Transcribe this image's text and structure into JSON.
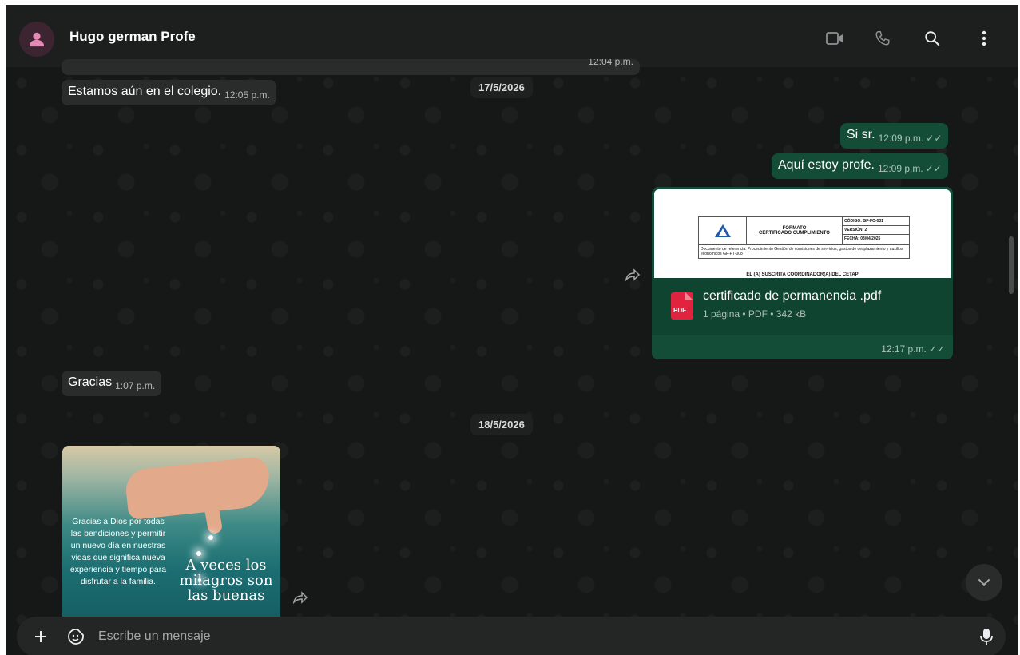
{
  "header": {
    "contact_name": "Hugo german Profe",
    "icons": [
      "video-call-icon",
      "voice-call-icon",
      "search-icon",
      "menu-icon"
    ]
  },
  "chat": {
    "partial_time": "12:04 p.m.",
    "dates": [
      "17/5/2026",
      "18/5/2026"
    ],
    "messages": [
      {
        "direction": "in",
        "text": "Estamos aún en el colegio.",
        "time": "12:05 p.m."
      },
      {
        "direction": "out",
        "text": "Si sr.",
        "time": "12:09 p.m."
      },
      {
        "direction": "out",
        "text": "Aquí estoy profe.",
        "time": "12:09 p.m."
      },
      {
        "direction": "in",
        "text": "Gracias",
        "time": "1:07 p.m."
      }
    ],
    "document": {
      "filename": "certificado de permanencia .pdf",
      "meta": "1 página • PDF • 342 kB",
      "time": "12:17 p.m.",
      "icon_label": "PDF",
      "preview": {
        "title_line1": "FORMATO",
        "title_line2": "CERTIFICADO CUMPLIMIENTO",
        "code": "CÓDIGO: GF-FO-031",
        "version": "VERSIÓN: 2",
        "date": "FECHA: 03/04/2025",
        "reference": "Documento de referencia: Procedimiento Gestión de comisiones de servicios, gastos de desplazamiento y auxilios económicos GF-PT-008",
        "heading": "EL (A) SUSCRITA COORDINADOR(A) DEL CETAP"
      }
    },
    "image_message": {
      "left_text": "Gracias a Dios por todas las bendiciones y permitir un nuevo día en nuestras vidas que significa nueva experiencia y tiempo para disfrutar a la familia.",
      "right_text": "A veces los milagros son las buenas"
    }
  },
  "composer": {
    "placeholder": "Escribe un mensaje"
  },
  "colors": {
    "background": "#161717",
    "incoming_bubble": "#2a2c2c",
    "outgoing_bubble": "#144d37",
    "pdf_red": "#e0233f"
  }
}
